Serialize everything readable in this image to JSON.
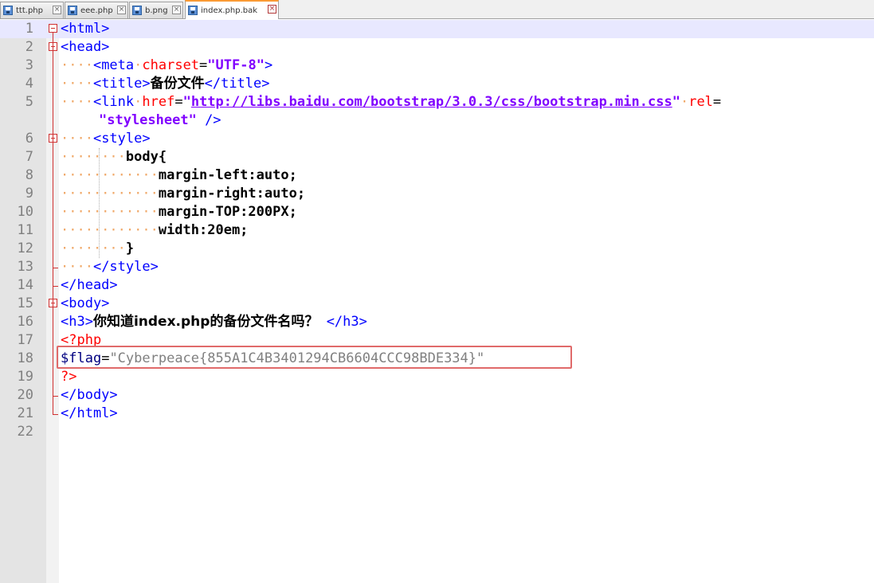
{
  "tabs": [
    {
      "label": "ttt.php"
    },
    {
      "label": "eee.php"
    },
    {
      "label": "b.png"
    },
    {
      "label": "index.php.bak"
    }
  ],
  "tab_close_glyph": "×",
  "indent_dots": {
    "d4": "····",
    "d8": "········",
    "d12": "············"
  },
  "lines": {
    "l1": {
      "num": "1",
      "open": "<html>"
    },
    "l2": {
      "num": "2",
      "open": "<head>"
    },
    "l3": {
      "num": "3",
      "tag_open": "<meta",
      "attr": "charset",
      "eq": "=",
      "value": "\"UTF-8\"",
      "tag_close": ">"
    },
    "l4": {
      "num": "4",
      "open": "<title>",
      "text": "备份文件",
      "close": "</title>"
    },
    "l5": {
      "num": "5",
      "tag_open": "<link",
      "attr1": "href",
      "eq1": "=",
      "q1": "\"",
      "url": "http://libs.baidu.com/bootstrap/3.0.3/css/bootstrap.min.css",
      "q2": "\"",
      "attr2": "rel",
      "eq2": "="
    },
    "l5b": {
      "value": "\"stylesheet\"",
      "tag_close": " />"
    },
    "l6": {
      "num": "6",
      "open": "<style>"
    },
    "l7": {
      "num": "7",
      "text": "body{"
    },
    "l8": {
      "num": "8",
      "text": "margin-left:auto;"
    },
    "l9": {
      "num": "9",
      "text": "margin-right:auto;"
    },
    "l10": {
      "num": "10",
      "text": "margin-TOP:200PX;"
    },
    "l11": {
      "num": "11",
      "text": "width:20em;"
    },
    "l12": {
      "num": "12",
      "text": "}"
    },
    "l13": {
      "num": "13",
      "close": "</style>"
    },
    "l14": {
      "num": "14",
      "close": "</head>"
    },
    "l15": {
      "num": "15",
      "open": "<body>"
    },
    "l16": {
      "num": "16",
      "open": "<h3>",
      "text": "你知道index.php的备份文件名吗？",
      "close": " </h3>"
    },
    "l17": {
      "num": "17",
      "php_open": "<?php"
    },
    "l18": {
      "num": "18",
      "var": "$flag",
      "eq": "=",
      "value": "\"Cyberpeace{855A1C4B3401294CB6604CCC98BDE334}\""
    },
    "l19": {
      "num": "19",
      "php_close": "?>"
    },
    "l20": {
      "num": "20",
      "close": "</body>"
    },
    "l21": {
      "num": "21",
      "close": "</html>"
    },
    "l22": {
      "num": "22"
    }
  },
  "colors": {
    "tag": "#0000ff",
    "attribute": "#ff0000",
    "string": "#8000ff",
    "php_delimiter": "#ff0000",
    "php_variable": "#000080",
    "php_string": "#808080",
    "active_tab_accent": "#fa9a34",
    "highlight_box": "#e06a6a"
  }
}
